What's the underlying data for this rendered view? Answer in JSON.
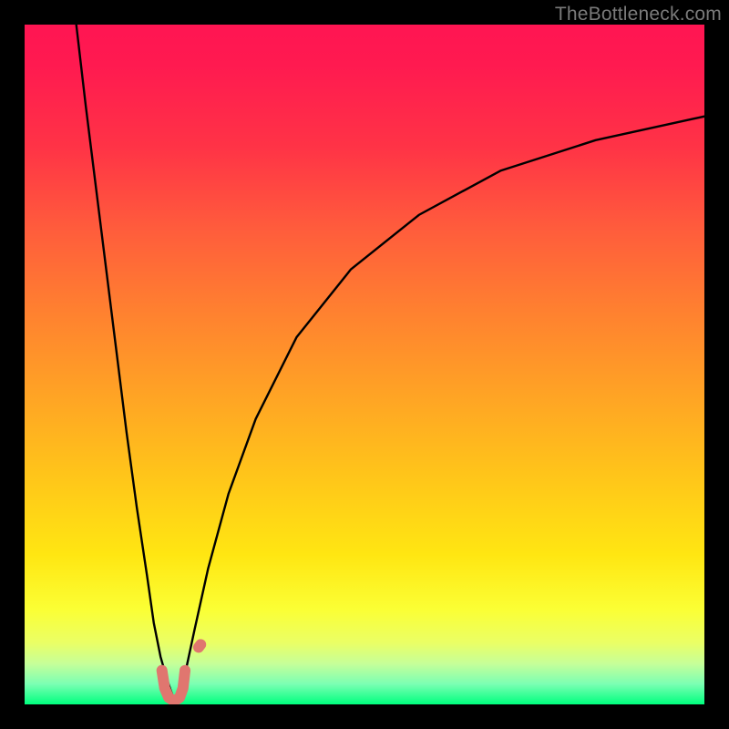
{
  "watermark": {
    "text": "TheBottleneck.com"
  },
  "chart_data": {
    "type": "line",
    "title": "",
    "xlabel": "",
    "ylabel": "",
    "xlim": [
      0,
      100
    ],
    "ylim": [
      0,
      100
    ],
    "grid": false,
    "legend": false,
    "background_gradient": {
      "orientation": "vertical",
      "stops": [
        {
          "pos": 0.0,
          "color": "#ff1552"
        },
        {
          "pos": 0.5,
          "color": "#ffa225"
        },
        {
          "pos": 0.85,
          "color": "#fbff34"
        },
        {
          "pos": 1.0,
          "color": "#00ff7e"
        }
      ]
    },
    "series": [
      {
        "name": "left-branch",
        "color": "#000000",
        "width": 2.4,
        "x": [
          7.6,
          9,
          10.5,
          12,
          13.5,
          15,
          16.5,
          18,
          19,
          20,
          21,
          21.8,
          22.3
        ],
        "y": [
          100,
          88,
          76,
          64,
          52,
          40,
          29,
          19,
          12,
          7,
          3.5,
          1.2,
          0.4
        ]
      },
      {
        "name": "right-branch",
        "color": "#000000",
        "width": 2.4,
        "x": [
          22.3,
          23.5,
          25,
          27,
          30,
          34,
          40,
          48,
          58,
          70,
          84,
          100
        ],
        "y": [
          0.4,
          4,
          11,
          20,
          31,
          42,
          54,
          64,
          72,
          78.5,
          83,
          86.5
        ]
      },
      {
        "name": "valley-marker",
        "color": "#e0766f",
        "width": 12,
        "x": [
          20.2,
          20.6,
          21.2,
          22.0,
          22.8,
          23.3,
          23.6
        ],
        "y": [
          5.0,
          2.4,
          1.0,
          0.5,
          1.0,
          2.4,
          5.0
        ]
      },
      {
        "name": "valley-dot",
        "color": "#e0766f",
        "width": 12,
        "x": [
          25.6,
          25.9
        ],
        "y": [
          8.4,
          8.8
        ]
      }
    ]
  }
}
